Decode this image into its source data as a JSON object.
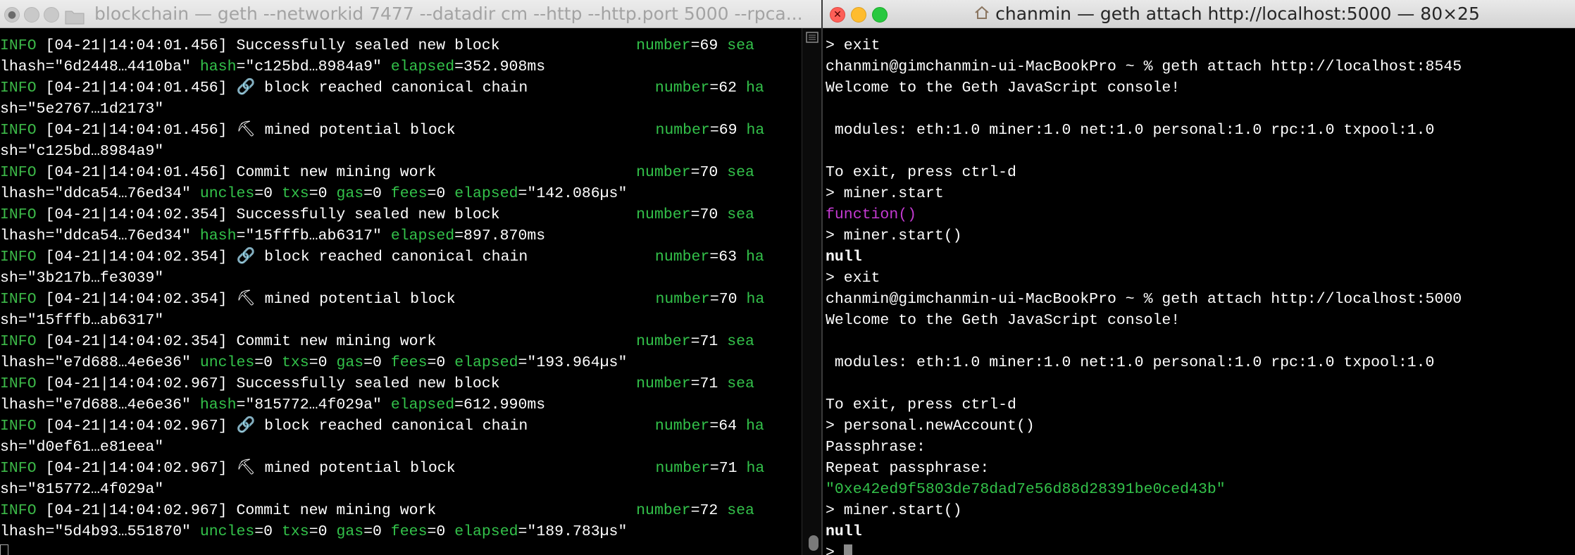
{
  "left_window": {
    "title": "blockchain — geth --networkid 7477 --datadir cm --http --http.port 5000 --rpca...",
    "lines": [
      [
        {
          "t": "INFO",
          "c": "c-info"
        },
        {
          "t": " [04-21|14:04:01.456] Successfully sealed new block               "
        },
        {
          "t": "number",
          "c": "c-key"
        },
        {
          "t": "=69 "
        },
        {
          "t": "sea",
          "c": "c-sea"
        }
      ],
      [
        {
          "t": "lhash=\"6d2448…4410ba\" "
        },
        {
          "t": "hash",
          "c": "c-key"
        },
        {
          "t": "=\"c125bd…8984a9\" "
        },
        {
          "t": "elapsed",
          "c": "c-key"
        },
        {
          "t": "=352.908ms"
        }
      ],
      [
        {
          "t": "INFO",
          "c": "c-info"
        },
        {
          "t": " [04-21|14:04:01.456] 🔗 block reached canonical chain              "
        },
        {
          "t": "number",
          "c": "c-key"
        },
        {
          "t": "=62 "
        },
        {
          "t": "ha",
          "c": "c-sea"
        }
      ],
      [
        {
          "t": "sh=\"5e2767…1d2173\""
        }
      ],
      [
        {
          "t": "INFO",
          "c": "c-info"
        },
        {
          "t": " [04-21|14:04:01.456] ⛏ mined potential block                      "
        },
        {
          "t": "number",
          "c": "c-key"
        },
        {
          "t": "=69 "
        },
        {
          "t": "ha",
          "c": "c-sea"
        }
      ],
      [
        {
          "t": "sh=\"c125bd…8984a9\""
        }
      ],
      [
        {
          "t": "INFO",
          "c": "c-info"
        },
        {
          "t": " [04-21|14:04:01.456] Commit new mining work                      "
        },
        {
          "t": "number",
          "c": "c-key"
        },
        {
          "t": "=70 "
        },
        {
          "t": "sea",
          "c": "c-sea"
        }
      ],
      [
        {
          "t": "lhash=\"ddca54…76ed34\" "
        },
        {
          "t": "uncles",
          "c": "c-key"
        },
        {
          "t": "=0 "
        },
        {
          "t": "txs",
          "c": "c-key"
        },
        {
          "t": "=0 "
        },
        {
          "t": "gas",
          "c": "c-key"
        },
        {
          "t": "=0 "
        },
        {
          "t": "fees",
          "c": "c-key"
        },
        {
          "t": "=0 "
        },
        {
          "t": "elapsed",
          "c": "c-key"
        },
        {
          "t": "=\"142.086µs\""
        }
      ],
      [
        {
          "t": "INFO",
          "c": "c-info"
        },
        {
          "t": " [04-21|14:04:02.354] Successfully sealed new block               "
        },
        {
          "t": "number",
          "c": "c-key"
        },
        {
          "t": "=70 "
        },
        {
          "t": "sea",
          "c": "c-sea"
        }
      ],
      [
        {
          "t": "lhash=\"ddca54…76ed34\" "
        },
        {
          "t": "hash",
          "c": "c-key"
        },
        {
          "t": "=\"15fffb…ab6317\" "
        },
        {
          "t": "elapsed",
          "c": "c-key"
        },
        {
          "t": "=897.870ms"
        }
      ],
      [
        {
          "t": "INFO",
          "c": "c-info"
        },
        {
          "t": " [04-21|14:04:02.354] 🔗 block reached canonical chain              "
        },
        {
          "t": "number",
          "c": "c-key"
        },
        {
          "t": "=63 "
        },
        {
          "t": "ha",
          "c": "c-sea"
        }
      ],
      [
        {
          "t": "sh=\"3b217b…fe3039\""
        }
      ],
      [
        {
          "t": "INFO",
          "c": "c-info"
        },
        {
          "t": " [04-21|14:04:02.354] ⛏ mined potential block                      "
        },
        {
          "t": "number",
          "c": "c-key"
        },
        {
          "t": "=70 "
        },
        {
          "t": "ha",
          "c": "c-sea"
        }
      ],
      [
        {
          "t": "sh=\"15fffb…ab6317\""
        }
      ],
      [
        {
          "t": "INFO",
          "c": "c-info"
        },
        {
          "t": " [04-21|14:04:02.354] Commit new mining work                      "
        },
        {
          "t": "number",
          "c": "c-key"
        },
        {
          "t": "=71 "
        },
        {
          "t": "sea",
          "c": "c-sea"
        }
      ],
      [
        {
          "t": "lhash=\"e7d688…4e6e36\" "
        },
        {
          "t": "uncles",
          "c": "c-key"
        },
        {
          "t": "=0 "
        },
        {
          "t": "txs",
          "c": "c-key"
        },
        {
          "t": "=0 "
        },
        {
          "t": "gas",
          "c": "c-key"
        },
        {
          "t": "=0 "
        },
        {
          "t": "fees",
          "c": "c-key"
        },
        {
          "t": "=0 "
        },
        {
          "t": "elapsed",
          "c": "c-key"
        },
        {
          "t": "=\"193.964µs\""
        }
      ],
      [
        {
          "t": "INFO",
          "c": "c-info"
        },
        {
          "t": " [04-21|14:04:02.967] Successfully sealed new block               "
        },
        {
          "t": "number",
          "c": "c-key"
        },
        {
          "t": "=71 "
        },
        {
          "t": "sea",
          "c": "c-sea"
        }
      ],
      [
        {
          "t": "lhash=\"e7d688…4e6e36\" "
        },
        {
          "t": "hash",
          "c": "c-key"
        },
        {
          "t": "=\"815772…4f029a\" "
        },
        {
          "t": "elapsed",
          "c": "c-key"
        },
        {
          "t": "=612.990ms"
        }
      ],
      [
        {
          "t": "INFO",
          "c": "c-info"
        },
        {
          "t": " [04-21|14:04:02.967] 🔗 block reached canonical chain              "
        },
        {
          "t": "number",
          "c": "c-key"
        },
        {
          "t": "=64 "
        },
        {
          "t": "ha",
          "c": "c-sea"
        }
      ],
      [
        {
          "t": "sh=\"d0ef61…e81eea\""
        }
      ],
      [
        {
          "t": "INFO",
          "c": "c-info"
        },
        {
          "t": " [04-21|14:04:02.967] ⛏ mined potential block                      "
        },
        {
          "t": "number",
          "c": "c-key"
        },
        {
          "t": "=71 "
        },
        {
          "t": "ha",
          "c": "c-sea"
        }
      ],
      [
        {
          "t": "sh=\"815772…4f029a\""
        }
      ],
      [
        {
          "t": "INFO",
          "c": "c-info"
        },
        {
          "t": " [04-21|14:04:02.967] Commit new mining work                      "
        },
        {
          "t": "number",
          "c": "c-key"
        },
        {
          "t": "=72 "
        },
        {
          "t": "sea",
          "c": "c-sea"
        }
      ],
      [
        {
          "t": "lhash=\"5d4b93…551870\" "
        },
        {
          "t": "uncles",
          "c": "c-key"
        },
        {
          "t": "=0 "
        },
        {
          "t": "txs",
          "c": "c-key"
        },
        {
          "t": "=0 "
        },
        {
          "t": "gas",
          "c": "c-key"
        },
        {
          "t": "=0 "
        },
        {
          "t": "fees",
          "c": "c-key"
        },
        {
          "t": "=0 "
        },
        {
          "t": "elapsed",
          "c": "c-key"
        },
        {
          "t": "=\"189.783µs\""
        }
      ]
    ]
  },
  "right_window": {
    "title": "chanmin — geth attach http://localhost:5000 — 80×25",
    "lines": [
      [
        {
          "t": "> exit"
        }
      ],
      [
        {
          "t": "chanmin@gimchanmin-ui-MacBookPro ~ % geth attach http://localhost:8545"
        }
      ],
      [
        {
          "t": "Welcome to the Geth JavaScript console!"
        }
      ],
      [
        {
          "t": ""
        }
      ],
      [
        {
          "t": " modules: eth:1.0 miner:1.0 net:1.0 personal:1.0 rpc:1.0 txpool:1.0"
        }
      ],
      [
        {
          "t": ""
        }
      ],
      [
        {
          "t": "To exit, press ctrl-d"
        }
      ],
      [
        {
          "t": "> miner.start"
        }
      ],
      [
        {
          "t": "function()",
          "c": "c-func"
        }
      ],
      [
        {
          "t": "> miner.start()"
        }
      ],
      [
        {
          "t": "null",
          "c": "c-bold"
        }
      ],
      [
        {
          "t": "> exit"
        }
      ],
      [
        {
          "t": "chanmin@gimchanmin-ui-MacBookPro ~ % geth attach http://localhost:5000"
        }
      ],
      [
        {
          "t": "Welcome to the Geth JavaScript console!"
        }
      ],
      [
        {
          "t": ""
        }
      ],
      [
        {
          "t": " modules: eth:1.0 miner:1.0 net:1.0 personal:1.0 rpc:1.0 txpool:1.0"
        }
      ],
      [
        {
          "t": ""
        }
      ],
      [
        {
          "t": "To exit, press ctrl-d"
        }
      ],
      [
        {
          "t": "> personal.newAccount()"
        }
      ],
      [
        {
          "t": "Passphrase:"
        }
      ],
      [
        {
          "t": "Repeat passphrase:"
        }
      ],
      [
        {
          "t": "\"0xe42ed9f5803de78dad7e56d88d28391be0ced43b\"",
          "c": "c-str"
        }
      ],
      [
        {
          "t": "> miner.start()"
        }
      ],
      [
        {
          "t": "null",
          "c": "c-bold"
        }
      ],
      [
        {
          "t": "> "
        }
      ]
    ]
  },
  "icons": {
    "left_folder": "folder-icon",
    "right_home": "home-icon",
    "scroll": "scroll-icon"
  }
}
